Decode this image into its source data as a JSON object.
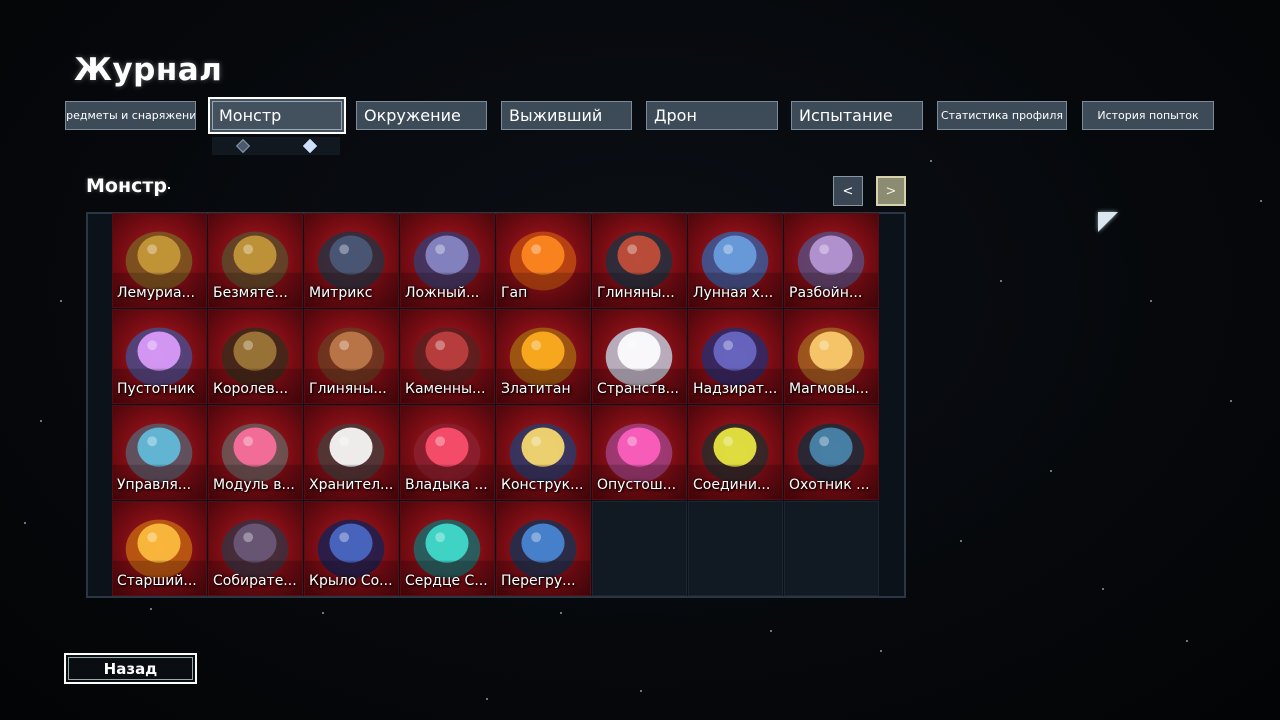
{
  "title": "Журнал",
  "tabs": [
    {
      "id": "items",
      "label": "Предметы и снаряжение",
      "size": "small",
      "active": false
    },
    {
      "id": "monster",
      "label": "Монстр",
      "size": "big",
      "active": true
    },
    {
      "id": "environment",
      "label": "Окружение",
      "size": "big",
      "active": false
    },
    {
      "id": "survivor",
      "label": "Выживший",
      "size": "big",
      "active": false
    },
    {
      "id": "drone",
      "label": "Дрон",
      "size": "big",
      "active": false
    },
    {
      "id": "challenge",
      "label": "Испытание",
      "size": "big",
      "active": false
    },
    {
      "id": "profile-stats",
      "label": "Статистика профиля",
      "size": "small",
      "active": false
    },
    {
      "id": "run-history",
      "label": "История попыток",
      "size": "small",
      "active": false
    }
  ],
  "section": {
    "title": "Монстр"
  },
  "pager": {
    "prev_label": "<",
    "next_label": ">"
  },
  "back_label": "Назад",
  "colors": {
    "accent": "#ffffff",
    "tab_bg": "#3d4a58",
    "cell_bg": "#9a1620",
    "empty_cell": "#111922",
    "page_bg": "#06080b"
  },
  "monsters": [
    {
      "label": "Лемуриа...",
      "icon": "lemurian-icon"
    },
    {
      "label": "Безмяте...",
      "icon": "stone-golem-icon"
    },
    {
      "label": "Митрикс",
      "icon": "mithrix-icon"
    },
    {
      "label": "Ложный...",
      "icon": "false-son-icon"
    },
    {
      "label": "Гап",
      "icon": "gup-icon"
    },
    {
      "label": "Глиняны...",
      "icon": "clay-templar-icon"
    },
    {
      "label": "Лунная х...",
      "icon": "lunar-chimera-icon"
    },
    {
      "label": "Разбойн...",
      "icon": "hermit-crab-icon"
    },
    {
      "label": "Пустотник",
      "icon": "void-reaver-icon"
    },
    {
      "label": "Королев...",
      "icon": "beetle-queen-icon"
    },
    {
      "label": "Глиняны...",
      "icon": "clay-dunestrider-icon"
    },
    {
      "label": "Каменны...",
      "icon": "stone-titan-icon"
    },
    {
      "label": "Златитан",
      "icon": "aurelionite-icon"
    },
    {
      "label": "Странств...",
      "icon": "jellyfish-icon"
    },
    {
      "label": "Надзират...",
      "icon": "overseer-icon"
    },
    {
      "label": "Магмовы...",
      "icon": "magma-worm-icon"
    },
    {
      "label": "Управля...",
      "icon": "control-unit-icon"
    },
    {
      "label": "Модуль в...",
      "icon": "module-icon"
    },
    {
      "label": "Хранител...",
      "icon": "guardian-icon"
    },
    {
      "label": "Владыка ...",
      "icon": "overlord-icon"
    },
    {
      "label": "Конструк...",
      "icon": "construct-icon"
    },
    {
      "label": "Опустош...",
      "icon": "devastator-icon"
    },
    {
      "label": "Соедини...",
      "icon": "connector-icon"
    },
    {
      "label": "Охотник ...",
      "icon": "hunter-icon"
    },
    {
      "label": "Старший...",
      "icon": "elder-icon"
    },
    {
      "label": "Собирате...",
      "icon": "collector-icon"
    },
    {
      "label": "Крыло Со...",
      "icon": "wing-icon"
    },
    {
      "label": "Сердце С...",
      "icon": "heart-icon"
    },
    {
      "label": "Перегру...",
      "icon": "overloader-icon"
    }
  ],
  "grid": {
    "columns": 8,
    "total_slots": 32
  }
}
